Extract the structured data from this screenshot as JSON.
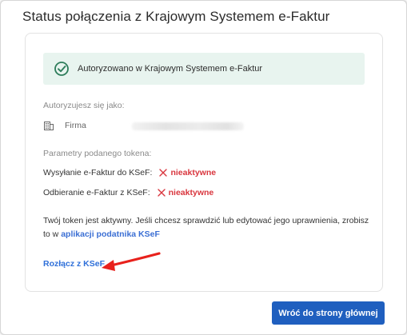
{
  "dialog": {
    "title": "Status połączenia z Krajowym Systemem e-Faktur"
  },
  "status_banner": {
    "icon": "check-circle-icon",
    "text": "Autoryzowano w Krajowym Systemem e-Faktur",
    "background": "#e8f4ef",
    "icon_color": "#2e7d5b"
  },
  "identity": {
    "heading": "Autoryzujesz się jako:",
    "icon": "building-icon",
    "label": "Firma"
  },
  "token": {
    "heading": "Parametry podanego tokena:",
    "permissions": [
      {
        "label": "Wysyłanie e-Faktur do KSeF:",
        "status": "nieaktywne",
        "status_icon": "x-icon"
      },
      {
        "label": "Odbieranie e-Faktur z KSeF:",
        "status": "nieaktywne",
        "status_icon": "x-icon"
      }
    ],
    "status_color": "#d9363e"
  },
  "info": {
    "text_before": "Twój token jest aktywny. Jeśli chcesz sprawdzić lub edytować jego uprawnienia, zrobisz to w ",
    "link_text": "aplikacji podatnika KSeF"
  },
  "actions": {
    "disconnect_label": "Rozłącz z KSeF",
    "home_button_label": "Wróć do strony głównej",
    "accent_color": "#1f5fbf"
  },
  "annotation": {
    "arrow_color": "#e8211c"
  }
}
